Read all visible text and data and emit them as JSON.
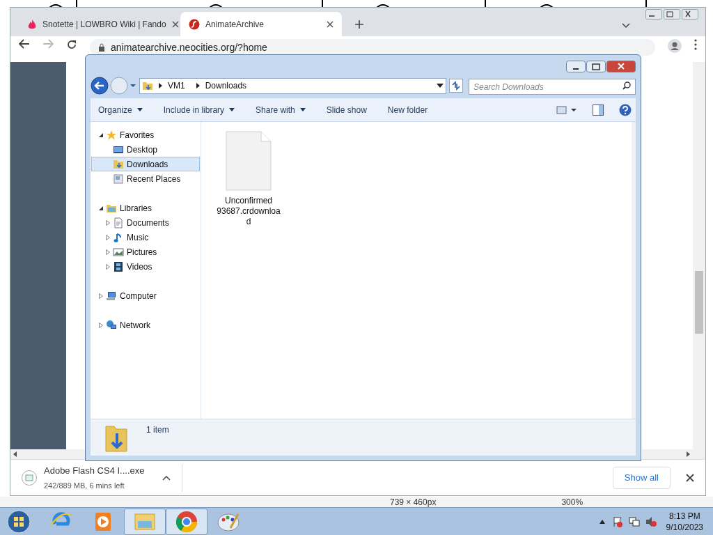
{
  "browser": {
    "tabs": [
      {
        "title": "Snotette | LOWBRO Wiki | Fando",
        "selected": false
      },
      {
        "title": "AnimateArchive",
        "selected": true
      }
    ],
    "address": "animatearchive.neocities.org/?home",
    "downloads": {
      "file": "Adobe Flash CS4 I....exe",
      "progress": "242/889 MB, 6 mins left",
      "show_all": "Show all"
    }
  },
  "explorer": {
    "breadcrumb": [
      "VM1",
      "Downloads"
    ],
    "search": {
      "placeholder": "Search Downloads"
    },
    "toolbar": [
      {
        "label": "Organize",
        "dropdown": true
      },
      {
        "label": "Include in library",
        "dropdown": true
      },
      {
        "label": "Share with",
        "dropdown": true
      },
      {
        "label": "Slide show",
        "dropdown": false
      },
      {
        "label": "New folder",
        "dropdown": false
      }
    ],
    "nav": [
      {
        "label": "Favorites",
        "selected": false,
        "expanded": true,
        "children": [
          {
            "label": "Desktop",
            "selected": false
          },
          {
            "label": "Downloads",
            "selected": true
          },
          {
            "label": "Recent Places",
            "selected": false
          }
        ]
      },
      {
        "label": "Libraries",
        "selected": false,
        "expanded": true,
        "children": [
          {
            "label": "Documents",
            "selected": false,
            "expanded": false
          },
          {
            "label": "Music",
            "selected": false,
            "expanded": false
          },
          {
            "label": "Pictures",
            "selected": false,
            "expanded": false
          },
          {
            "label": "Videos",
            "selected": false,
            "expanded": false
          }
        ]
      },
      {
        "label": "Computer",
        "selected": false,
        "expanded": false
      },
      {
        "label": "Network",
        "selected": false,
        "expanded": false
      }
    ],
    "files": [
      {
        "name": "Unconfirmed 93687.crdownload"
      }
    ],
    "status": "1 item"
  },
  "viewer_status": {
    "size": "739 × 460px",
    "zoom": "300%"
  },
  "taskbar": {
    "apps": [
      {
        "active": false
      },
      {
        "active": false
      },
      {
        "active": true
      },
      {
        "active": true
      },
      {
        "active": false
      }
    ],
    "time": "8:13 PM",
    "date": "9/10/2023"
  }
}
